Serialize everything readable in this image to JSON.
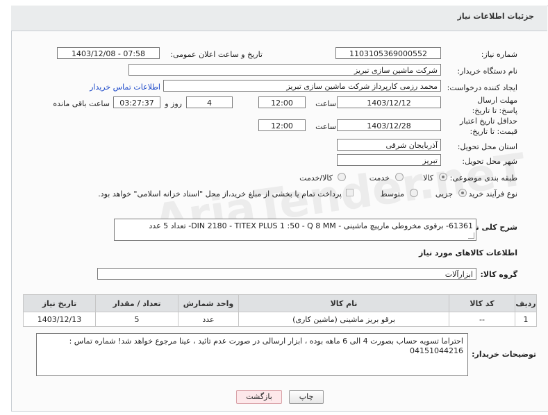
{
  "header": {
    "title": "جزئیات اطلاعات نیاز"
  },
  "form": {
    "need_number_label": "شماره نیاز:",
    "need_number": "1103105369000552",
    "announce_label": "تاریخ و ساعت اعلان عمومی:",
    "announce_value": "1403/12/08 - 07:58",
    "buyer_org_label": "نام دستگاه خریدار:",
    "buyer_org": "شرکت ماشین سازی تبریز",
    "requester_label": "ایجاد کننده درخواست:",
    "requester": "محمد رزمی کارپرداز شرکت ماشین سازی تبریز",
    "contact_link": "اطلاعات تماس خریدار",
    "reply_deadline_label": "مهلت ارسال پاسخ: تا تاریخ:",
    "reply_date": "1403/12/12",
    "time_label": "ساعت",
    "reply_time": "12:00",
    "days_value": "4",
    "days_label": "روز و",
    "remaining_time": "03:27:37",
    "remaining_label": "ساعت باقی مانده",
    "price_validity_label": "حداقل تاریخ اعتبار قیمت: تا تاریخ:",
    "price_date": "1403/12/28",
    "price_time": "12:00",
    "province_label": "استان محل تحویل:",
    "province": "آذربایجان شرقی",
    "city_label": "شهر محل تحویل:",
    "city": "تبریز",
    "category_label": "طبقه بندی موضوعی:",
    "category_options": [
      "کالا",
      "خدمت",
      "کالا/خدمت"
    ],
    "category_selected": "کالا",
    "process_label": "نوع فرآیند خرید :",
    "process_options": [
      "جزیی",
      "متوسط"
    ],
    "process_selected": "جزیی",
    "payment_note": "پرداخت تمام یا بخشی از مبلغ خرید،از محل \"اسناد خزانه اسلامی\" خواهد بود."
  },
  "description": {
    "label": "شرح کلی نیاز:",
    "text": "61361- برقوی مخروطی مارپیچ ماشینی - DIN 2180 - TITEX PLUS 1 :50 - Q 8 MM- تعداد 5 عدد"
  },
  "goods_section": {
    "title": "اطلاعات کالاهای مورد نیاز",
    "group_label": "گروه کالا:",
    "group_value": "ابزارآلات",
    "columns": [
      "ردیف",
      "کد کالا",
      "نام کالا",
      "واحد شمارش",
      "تعداد / مقدار",
      "تاریخ نیاز"
    ],
    "rows": [
      {
        "row": "1",
        "code": "--",
        "name": "برقو بریز ماشینی (ماشین کاری)",
        "unit": "عدد",
        "qty": "5",
        "date": "1403/12/13"
      }
    ]
  },
  "buyer_notes": {
    "label": "توضیحات خریدار:",
    "text": "احتراما تسویه حساب بصورت 4 الی 6 ماهه بوده ، ابزار ارسالی در صورت عدم تائید ، عینا مرجوع خواهد شد! شماره تماس : 04151044216"
  },
  "buttons": {
    "print": "چاپ",
    "back": "بازگشت"
  },
  "watermark": "AriaTender.neT"
}
